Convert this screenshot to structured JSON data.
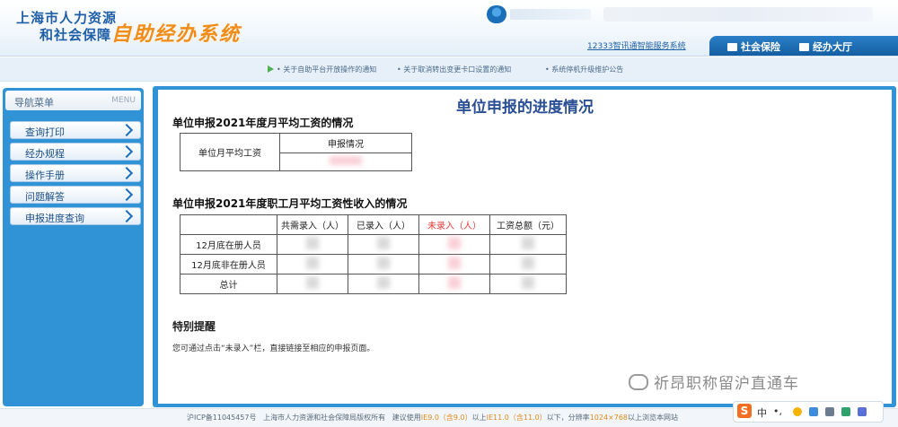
{
  "header": {
    "logo_line1": "上海市人力资源",
    "logo_line2": "和社会保障",
    "logo_main": "自助经办系统",
    "hotline": "12333智讯通智能服务系统",
    "tabs": [
      "社会保险",
      "经办大厅"
    ]
  },
  "notices": [
    "关于自助平台开放操作的通知",
    "关于取消转出变更卡口设置的通知",
    "系统停机升级维护公告"
  ],
  "sidebar": {
    "title": "导航菜单",
    "menu_en": "MENU",
    "items": [
      {
        "label": "查询打印"
      },
      {
        "label": "经办规程"
      },
      {
        "label": "操作手册"
      },
      {
        "label": "问题解答"
      },
      {
        "label": "申报进度查询"
      }
    ]
  },
  "main": {
    "title": "单位申报的进度情况",
    "section1": {
      "title": "单位申报2021年度月平均工资的情况",
      "row_label": "单位月平均工资",
      "col_header": "申报情况"
    },
    "section2": {
      "title": "单位申报2021年度职工月平均工资性收入的情况",
      "headers": [
        "共需录入（人）",
        "已录入（人）",
        "未录入（人）",
        "工资总额（元）"
      ],
      "rows": [
        "12月底在册人员",
        "12月底非在册人员",
        "总计"
      ]
    },
    "reminder": {
      "title": "特别提醒",
      "text": "您可通过点击“未录入”栏，直接链接至相应的申报页面。"
    }
  },
  "watermark": "祈昂职称留沪直通车",
  "footer": {
    "icp": "沪ICP备11045457号",
    "copyright": "上海市人力资源和社会保障局版权所有",
    "advice_prefix": "建议使用",
    "ie9": "IE9.0（含9.0）",
    "between": "以上",
    "ie11": "IE11.0（含11.0）",
    "resolution_prefix": "以下，分辨率",
    "resolution": "1024×768",
    "suffix": "以上浏览本网站"
  },
  "ime": {
    "logo": "S",
    "mode": "中",
    "punct": "•,"
  },
  "colors": {
    "brand_blue": "#2f93d6",
    "title_blue": "#2a4f95",
    "logo_orange": "#f08c1a",
    "alert_red": "#e53935"
  }
}
